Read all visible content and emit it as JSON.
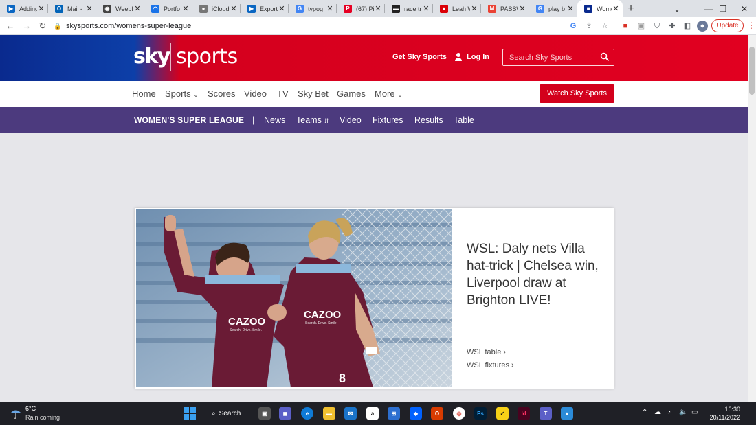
{
  "browser": {
    "tabs": [
      {
        "label": "Adding",
        "color": "#0a66c2",
        "glyph": "▶"
      },
      {
        "label": "Mail -",
        "color": "#0364b8",
        "glyph": "O"
      },
      {
        "label": "Weebl",
        "color": "#444",
        "glyph": "◉"
      },
      {
        "label": "Portfo",
        "color": "#1a73e8",
        "glyph": "◠"
      },
      {
        "label": "iCloud",
        "color": "#777",
        "glyph": "●"
      },
      {
        "label": "Export",
        "color": "#0a66c2",
        "glyph": "▶"
      },
      {
        "label": "typog",
        "color": "#4285f4",
        "glyph": "G"
      },
      {
        "label": "(67) Pi",
        "color": "#e60023",
        "glyph": "P"
      },
      {
        "label": "race tr",
        "color": "#222",
        "glyph": "▬"
      },
      {
        "label": "Leah W",
        "color": "#db0007",
        "glyph": "▲"
      },
      {
        "label": "PASSW",
        "color": "#ea4335",
        "glyph": "M"
      },
      {
        "label": "play b",
        "color": "#4285f4",
        "glyph": "G"
      },
      {
        "label": "Wome",
        "color": "#0a2a8e",
        "glyph": "■",
        "active": true
      }
    ],
    "new_tab": "+",
    "url": "skysports.com/womens-super-league",
    "update_label": "Update"
  },
  "site": {
    "logo_sky": "sky",
    "logo_sports": "sports",
    "get_sky": "Get Sky Sports",
    "login": "Log In",
    "search_placeholder": "Search Sky Sports",
    "main_nav": [
      "Home",
      "Sports",
      "Scores",
      "Video",
      "TV",
      "Sky Bet",
      "Games",
      "More"
    ],
    "watch_button": "Watch Sky Sports",
    "section_title": "WOMEN'S SUPER LEAGUE",
    "sub_nav": [
      "News",
      "Teams",
      "Video",
      "Fixtures",
      "Results",
      "Table"
    ]
  },
  "feature": {
    "headline": "WSL: Daly nets Villa hat-trick | Chelsea win, Liverpool draw at Brighton LIVE!",
    "links": [
      "WSL table",
      "WSL fixtures"
    ],
    "shirt_sponsor": "CAZOO",
    "shirt_tagline": "Search. Drive. Smile.",
    "shirt_number": "8"
  },
  "taskbar": {
    "temperature": "6°C",
    "weather": "Rain coming",
    "search": "Search",
    "time": "16:30",
    "date": "20/11/2022"
  },
  "colors": {
    "sky_red": "#e10020",
    "sky_blue": "#0a2a8e",
    "wsl_purple": "#4c3a7e",
    "watch_red": "#d3001c"
  }
}
